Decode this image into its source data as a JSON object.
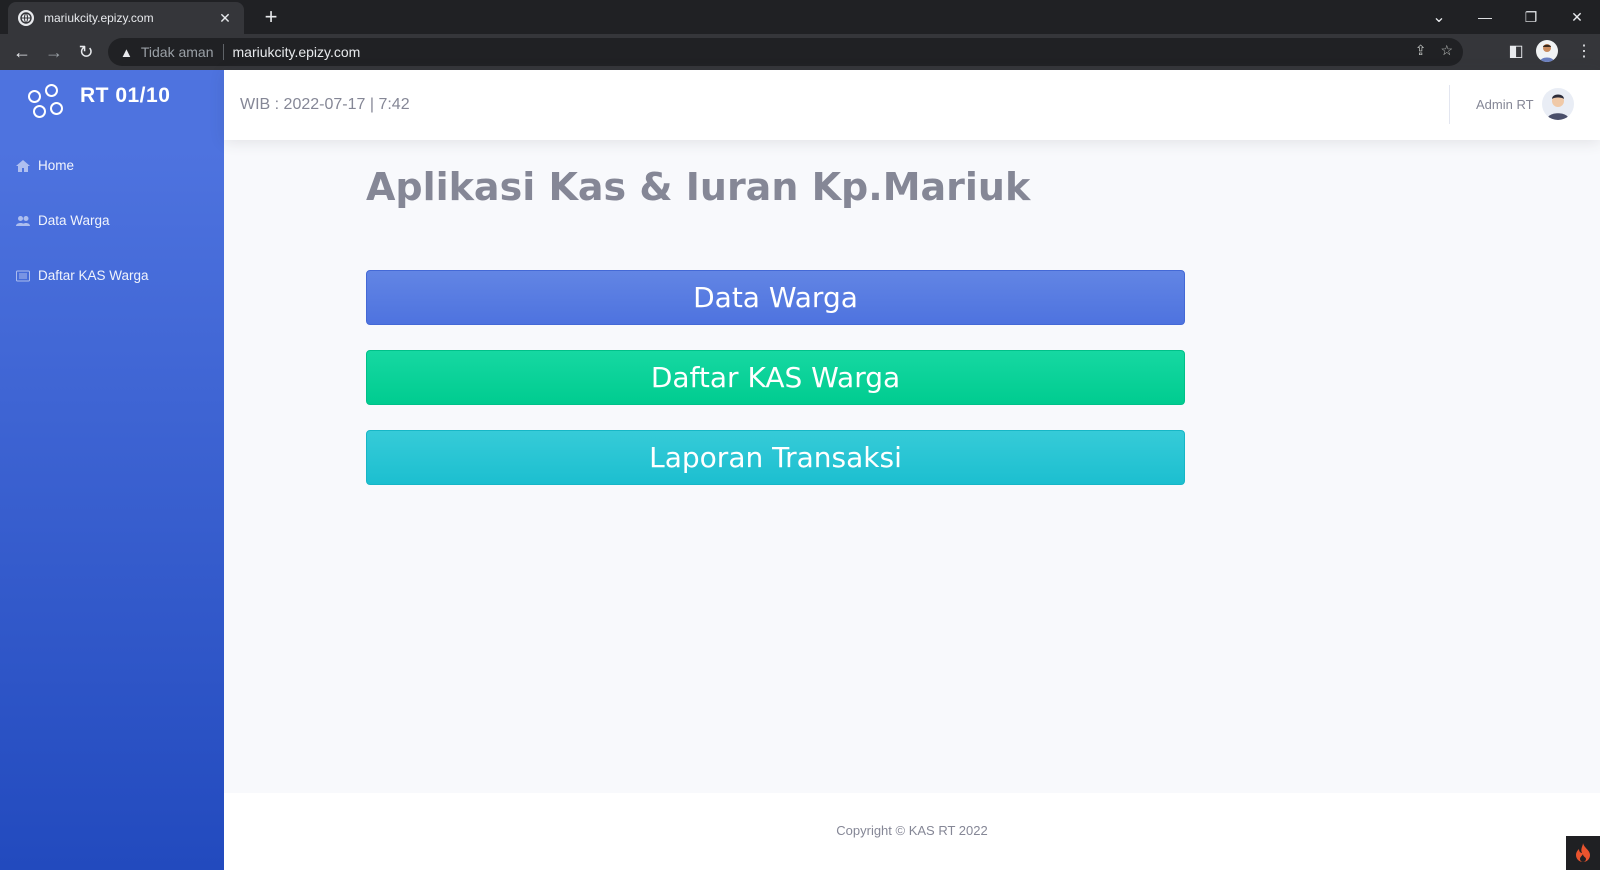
{
  "browser": {
    "tab_title": "mariukcity.epizy.com",
    "tab_close": "✕",
    "new_tab": "+",
    "insecure_label": "Tidak aman",
    "url": "mariukcity.epizy.com",
    "back": "←",
    "forward": "→",
    "reload": "↻",
    "warning_glyph": "▲",
    "share_glyph": "⇪",
    "star_glyph": "☆",
    "sidepanel_glyph": "◧",
    "menu_glyph": "⋮",
    "minimize": "—",
    "restore": "❐",
    "close": "✕",
    "tablist": "⌄"
  },
  "sidebar": {
    "brand": "RT 01/10",
    "items": [
      {
        "label": "Home",
        "icon": "home-icon"
      },
      {
        "label": "Data Warga",
        "icon": "users-icon"
      },
      {
        "label": "Daftar KAS Warga",
        "icon": "list-icon"
      }
    ]
  },
  "topbar": {
    "datetime": "WIB : 2022-07-17 | 7:42",
    "user_name": "Admin RT"
  },
  "main": {
    "title": "Aplikasi Kas & Iuran Kp.Mariuk",
    "buttons": [
      {
        "label": "Data Warga",
        "color": "#4e73df"
      },
      {
        "label": "Daftar KAS Warga",
        "color": "#1cc88a"
      },
      {
        "label": "Laporan Transaksi",
        "color": "#36b9cc"
      }
    ]
  },
  "footer": {
    "copyright": "Copyright © KAS RT 2022"
  }
}
